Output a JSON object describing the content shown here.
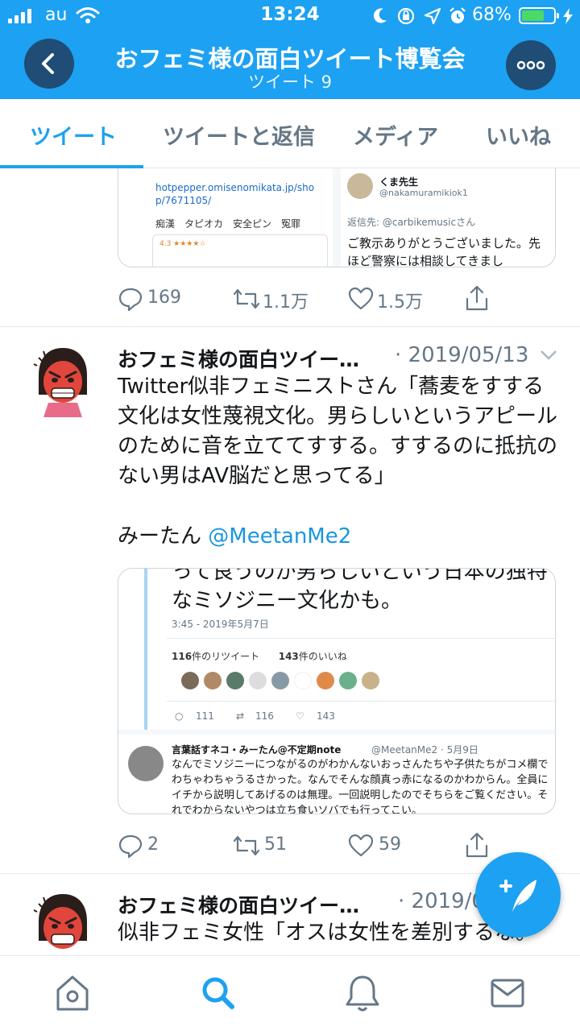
{
  "status_bar": {
    "carrier": "au",
    "time": "13:24",
    "battery": "68%"
  },
  "header": {
    "title": "おフェミ様の面白ツイート博覧会",
    "subtitle": "ツイート 9"
  },
  "tabs": [
    {
      "label": "ツイート"
    },
    {
      "label": "ツイートと返信"
    },
    {
      "label": "メディア"
    },
    {
      "label": "いいね"
    }
  ],
  "tweet1": {
    "card": {
      "left_url": "hotpepper.omisenomikata.jp/shop/7671105/",
      "left_tags": "痴漢　タピオカ　安全ピン　冤罪",
      "left_rating": "4.3 ★★★★☆",
      "right_user": "くま先生",
      "right_handle": "@nakamuramikiok1",
      "right_reply": "返信先: @carbikemusicさん",
      "right_text": "ご教示ありがとうございました。先ほど警察には相談してきまし"
    },
    "replies": "169",
    "retweets": "1.1万",
    "likes": "1.5万"
  },
  "tweet2": {
    "name": "おフェミ様の面白ツイー…",
    "date": "· 2019/05/13",
    "body": "Twitter似非フェミニストさん「蕎麦をすする文化は女性蔑視文化。男らしいというアピールのために音を立ててすする。すするのに抵抗のない男はAV脳だと思ってる」",
    "attribution": "みーたん",
    "mention": "@MeetanMe2",
    "card": {
      "top_text": "って良うのが男らしいという日本の独特なミソジニー文化かも。",
      "timestamp": "3:45 - 2019年5月7日",
      "rt_count": "116",
      "rt_label": "件のリツイート",
      "like_count": "143",
      "like_label": "件のいいね",
      "stat_reply": "111",
      "stat_rt": "116",
      "stat_like": "143",
      "reply_name": "言葉話すネコ・みーたん@不定期note",
      "reply_handle": "@MeetanMe2 · 5月9日",
      "reply_text": "なんでミソジニーにつながるのがわかんないおっさんたちや子供たちがコメ欄でわちゃわちゃうるさかった。なんでそんな顔真っ赤になるのかわからん。全員にイチから説明してあげるのは無理。一回説明したのでそちらをご覧ください。それでわからないやつは立ち食いソバでも行ってこい。"
    },
    "replies": "2",
    "retweets": "51",
    "likes": "59"
  },
  "tweet3": {
    "name": "おフェミ様の面白ツイー…",
    "date": "· 2019/0",
    "body": "似非フェミ女性「オスは女性を差別するな。"
  },
  "colors": {
    "accent": "#1da1f2",
    "header_btn": "#1f4d75",
    "muted": "#657786"
  }
}
